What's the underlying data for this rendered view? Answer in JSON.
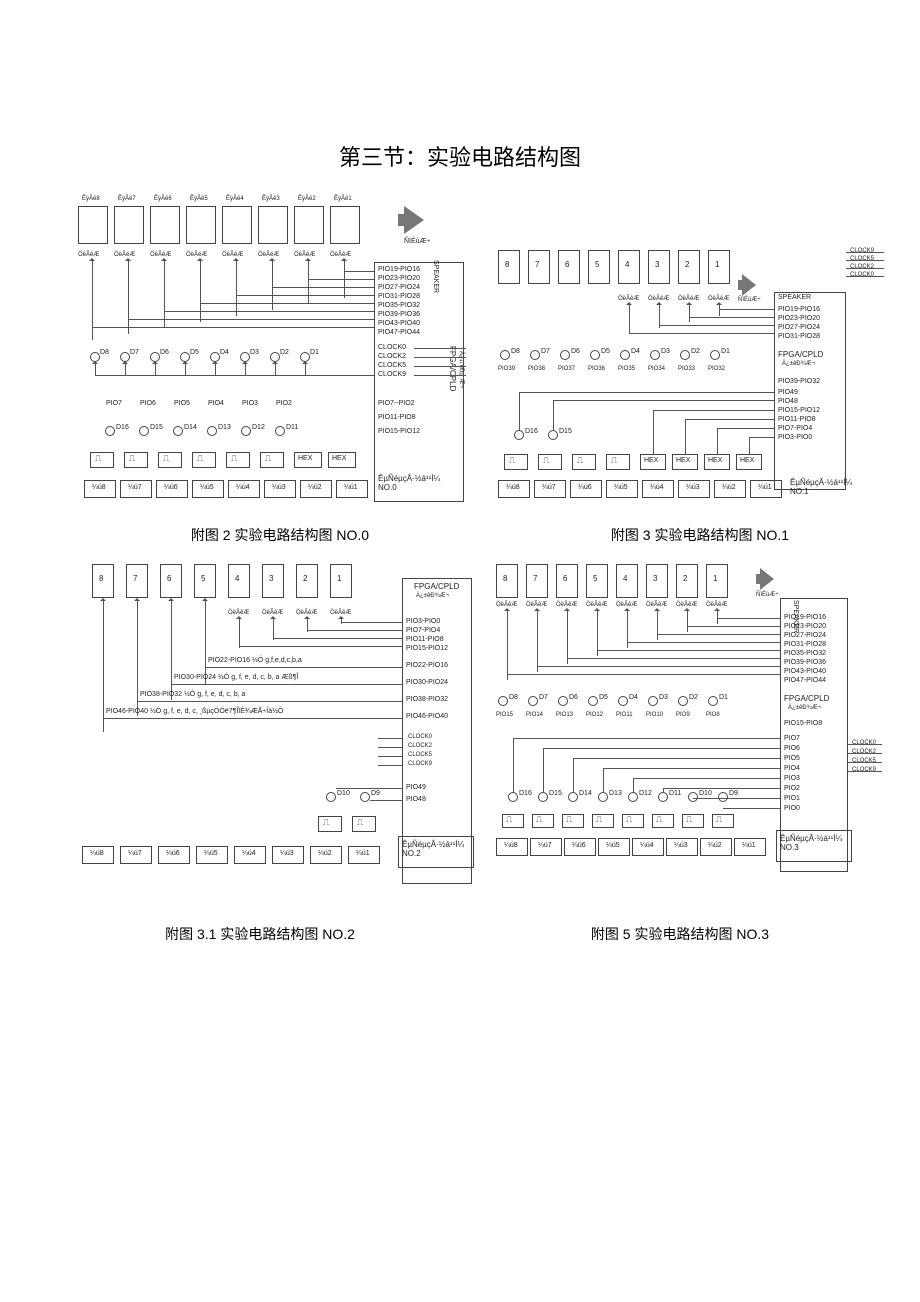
{
  "title": "第三节：实验电路结构图",
  "captions": {
    "c0": "附图 2   实验电路结构图 NO.0",
    "c1": "附图 3   实验电路结构图 NO.1",
    "c2": "附图 3.1   实验电路结构图 NO.2",
    "c3": "附图 5   实验电路结构图 NO.3"
  },
  "labels": {
    "d8": "D8",
    "d7": "D7",
    "d6": "D6",
    "d5": "D5",
    "d4": "D4",
    "d3": "D3",
    "d2": "D2",
    "d1": "D1",
    "d16": "D16",
    "d15": "D15",
    "d14": "D14",
    "d13": "D13",
    "d12": "D12",
    "d11": "D11",
    "d10": "D10",
    "d9": "D9",
    "hex": "HEX",
    "speaker": "SPEAKER",
    "seg567": "ÖëÂêÆ",
    "segAlt": "ÖëÂéÆ",
    "fpgacpld": "FPGA/CPLD",
    "fpgaLine2": "Ä¿±êÐ¾Æ¬",
    "speakerIcon": "ÑïÉùÆ÷",
    "disp": "ÊýÂë",
    "k1": "¼ú1",
    "k2": "¼ú2",
    "k3": "¼ú3",
    "k4": "¼ú4",
    "k5": "¼ú5",
    "k6": "¼ú6",
    "k7": "¼ú7",
    "k8": "¼ú8",
    "no0": "ÊµÑéµçÂ·½á¹¹Í¼\nNO.0",
    "no1": "ÊµÑéµçÂ·½á¹¹Í¼\nNO.1",
    "no2": "ÊµÑéµçÂ·½á¹¹Í¼\nNO.2",
    "no3": "ÊµÑéµçÂ·½á¹¹Í¼\nNO.3",
    "clock0": "CLOCK0",
    "clock2": "CLOCK2",
    "clock5": "CLOCK5",
    "clock9": "CLOCK9",
    "pio0": {
      "l0": "PIO19-PIO16",
      "l1": "PIO23-PIO20",
      "l2": "PIO27-PIO24",
      "l3": "PIO31-PIO28",
      "l4": "PIO35-PIO32",
      "l5": "PIO39-PIO36",
      "l6": "PIO43-PIO40",
      "l7": "PIO47-PIO44",
      "p2": "PIO2",
      "p3": "PIO3",
      "p4": "PIO4",
      "p5": "PIO5",
      "p6": "PIO6",
      "p7": "PIO7",
      "g1": "PIO7--PIO2",
      "g2": "PIO11-PIO8",
      "g3": "PIO15-PIO12"
    },
    "pio1": {
      "l0": "PIO19-PIO16",
      "l1": "PIO23-PIO20",
      "l2": "PIO27-PIO24",
      "l3": "PIO31-PIO28",
      "l4": "PIO39-PIO32",
      "l5": "PIO49",
      "l6": "PIO48",
      "l7": "PIO15-PIO12",
      "l8": "PIO11-PIO8",
      "l9": "PIO7-PIO4",
      "l10": "PIO3-PIO0",
      "p32": "PIO32",
      "p33": "PIO33",
      "p34": "PIO34",
      "p35": "PIO35",
      "p36": "PIO36",
      "p37": "PIO37",
      "p38": "PIO38",
      "p39": "PIO39"
    },
    "pio2": {
      "a": "PIO22-PIO16 ½Ó g,f,e,d,c,b,a",
      "b": "PIO30-PIO24 ½Ó g, f, e, d, c, b, a Æß¶Î",
      "c": "PIO38-PIO32 ½Ó g, f, e, d, c, b, a",
      "d": "PIO46-PIO40 ½Ó g, f, e, d, c, ¸ßµçÖÓë7¶ÎÏÈ¾ÆÅ÷Íà½Ó",
      "r0": "PIO3-PIO0",
      "r1": "PIO7-PIO4",
      "r2": "PIO11-PIO8",
      "r3": "PIO15-PIO12",
      "r4": "PIO22-PIO16",
      "r5": "PIO30-PIO24",
      "r6": "PIO38-PIO32",
      "r7": "PIO46-PIO40",
      "r8": "PIO49",
      "r9": "PIO48"
    },
    "pio3": {
      "l0": "PIO19-PIO16",
      "l1": "PIO23-PIO20",
      "l2": "PIO27-PIO24",
      "l3": "PIO31-PIO28",
      "l4": "PIO35-PIO32",
      "l5": "PIO39-PIO36",
      "l6": "PIO43-PIO40",
      "l7": "PIO47-PIO44",
      "m": "PIO15-PIO8",
      "p0": "PIO0",
      "p1": "PIO1",
      "p2": "PIO2",
      "p3": "PIO3",
      "p4": "PIO4",
      "p5": "PIO5",
      "p6": "PIO6",
      "p7": "PIO7",
      "d8": "PIO8",
      "d9": "PIO9",
      "d10": "PIO10",
      "d11": "PIO11",
      "d12": "PIO12",
      "d13": "PIO13",
      "d14": "PIO14",
      "d15": "PIO15"
    }
  }
}
